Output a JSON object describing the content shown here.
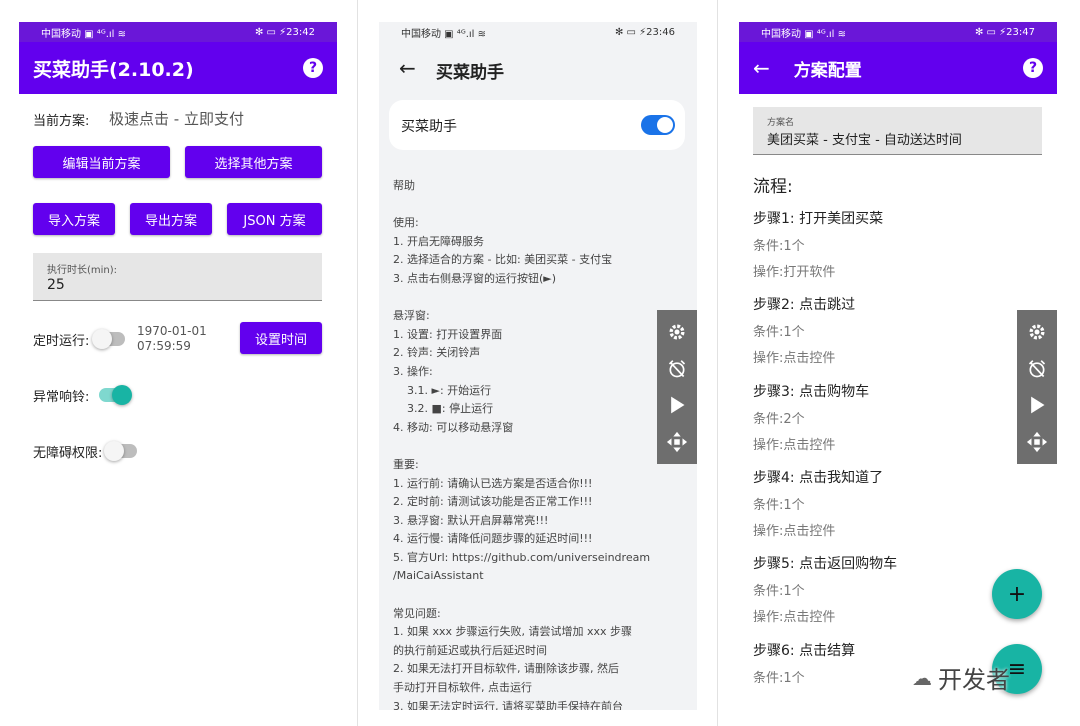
{
  "screen1": {
    "status": {
      "left": "中国移动 ▣ ⁴ᴳ.ıl ≋",
      "right": "✻ ▭ ⚡23:42"
    },
    "app_title": "买菜助手(2.10.2)",
    "current_plan_label": "当前方案:",
    "current_plan_value": "极速点击 - 立即支付",
    "buttons": {
      "edit": "编辑当前方案",
      "choose": "选择其他方案",
      "import": "导入方案",
      "export": "导出方案",
      "json": "JSON 方案",
      "set_time": "设置时间"
    },
    "duration": {
      "label": "执行时长(min):",
      "value": "25"
    },
    "timer": {
      "label": "定时运行:",
      "date": "1970-01-01",
      "time": "07:59:59",
      "enabled": false
    },
    "alarm": {
      "label": "异常响铃:",
      "enabled": true
    },
    "accessibility": {
      "label": "无障碍权限:",
      "enabled": false
    }
  },
  "screen2": {
    "status": {
      "left": "中国移动 ▣ ⁴ᴳ.ıl ≋",
      "right": "✻ ▭ ⚡23:46"
    },
    "title": "买菜助手",
    "toggle_label": "买菜助手",
    "toggle_on": true,
    "help_text": "帮助\n\n使用:\n1. 开启无障碍服务\n2. 选择适合的方案 - 比如: 美团买菜 - 支付宝\n3. 点击右侧悬浮窗的运行按钮(►)\n\n悬浮窗:\n1. 设置: 打开设置界面\n2. 铃声: 关闭铃声\n3. 操作:\n    3.1. ►: 开始运行\n    3.2. ■: 停止运行\n4. 移动: 可以移动悬浮窗\n\n重要:\n1. 运行前: 请确认已选方案是否适合你!!!\n2. 定时前: 请测试该功能是否正常工作!!!\n3. 悬浮窗: 默认开启屏幕常亮!!!\n4. 运行慢: 请降低问题步骤的延迟时间!!!\n5. 官方Url: https://github.com/universeindream\n/MaiCaiAssistant\n\n常见问题:\n1. 如果 xxx 步骤运行失败, 请尝试增加 xxx 步骤\n的执行前延迟或执行后延迟时间\n2. 如果无法打开目标软件, 请删除该步骤, 然后\n手动打开目标软件, 点击运行\n3. 如果无法定时运行, 请将买菜助手保持在前台"
  },
  "screen3": {
    "status": {
      "left": "中国移动 ▣ ⁴ᴳ.ıl ≋",
      "right": "✻ ▭ ⚡23:47"
    },
    "title": "方案配置",
    "plan_name_label": "方案名",
    "plan_name_value": "美团买菜 - 支付宝 - 自动送达时间",
    "flow_heading": "流程:",
    "steps": [
      {
        "title": "步骤1: 打开美团买菜",
        "cond": "条件:1个",
        "op": "操作:打开软件"
      },
      {
        "title": "步骤2: 点击跳过",
        "cond": "条件:1个",
        "op": "操作:点击控件"
      },
      {
        "title": "步骤3: 点击购物车",
        "cond": "条件:2个",
        "op": "操作:点击控件"
      },
      {
        "title": "步骤4: 点击我知道了",
        "cond": "条件:1个",
        "op": "操作:点击控件"
      },
      {
        "title": "步骤5: 点击返回购物车",
        "cond": "条件:1个",
        "op": "操作:点击控件"
      },
      {
        "title": "步骤6: 点击结算",
        "cond": "条件:1个",
        "op": ""
      }
    ],
    "fab_add": "+",
    "fab_save": "≡"
  },
  "watermark": "开发者",
  "colors": {
    "primary": "#6200ee",
    "accent": "#18b4a4",
    "blue_toggle": "#1a73e8",
    "float_panel": "#6e6e6e"
  }
}
